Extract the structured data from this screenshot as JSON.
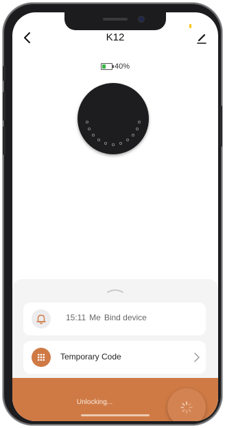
{
  "header": {
    "title": "K12",
    "back_icon": "chevron-left-icon",
    "edit_icon": "pencil-icon"
  },
  "battery": {
    "label": "40%",
    "level": 0.4,
    "fill_color": "#3cb34a"
  },
  "sheet": {
    "handle_icon": "chevron-up-icon",
    "log": {
      "icon": "bell-icon",
      "time": "15:11",
      "user": "Me",
      "event": "Bind device"
    },
    "temporary_code": {
      "icon": "keypad-icon",
      "label": "Temporary Code"
    }
  },
  "unlock": {
    "status": "Unlocking...",
    "icon": "spinner-icon"
  },
  "colors": {
    "accent": "#cf7a45",
    "device": "#1d1d1f",
    "sheet_background": "#f4f4f5"
  }
}
